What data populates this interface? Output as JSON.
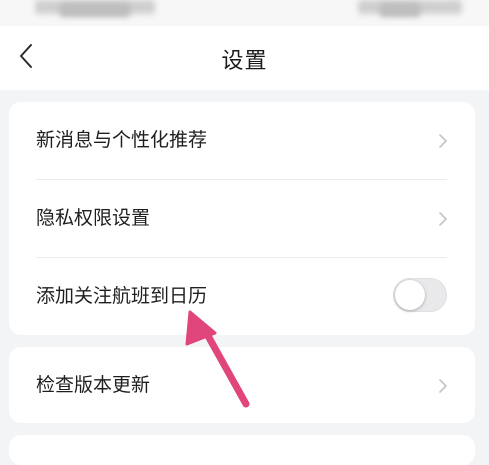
{
  "header": {
    "title": "设置"
  },
  "settings_group_1": {
    "items": [
      {
        "label": "新消息与个性化推荐"
      },
      {
        "label": "隐私权限设置"
      },
      {
        "label": "添加关注航班到日历",
        "toggle_on": false
      }
    ]
  },
  "settings_group_2": {
    "items": [
      {
        "label": "检查版本更新"
      }
    ]
  },
  "colors": {
    "annotation_arrow": "#e0457b",
    "toggle_off_track": "#e9e9eb",
    "page_background": "#f3f4f6"
  },
  "icons": {
    "back": "chevron-left-icon",
    "row_chevron": "chevron-right-icon"
  }
}
